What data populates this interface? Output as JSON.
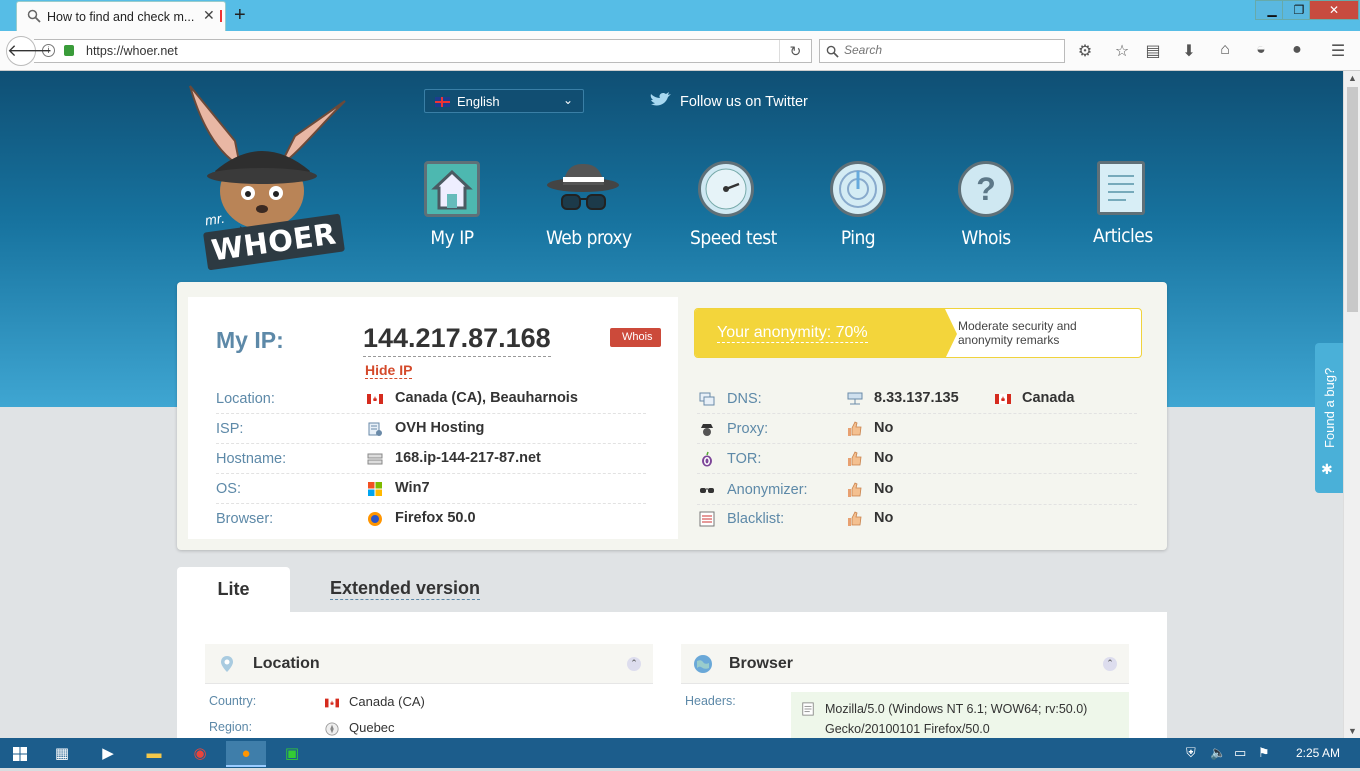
{
  "browser": {
    "tab_title": "How to find and check m...",
    "url": "https://whoer.net",
    "search_placeholder": "Search",
    "window_min": "▁",
    "window_max": "❐",
    "window_close": "✕"
  },
  "site": {
    "logo_mr": "mr.",
    "logo_name": "WHOER",
    "language": "English",
    "twitter": "Follow us on Twitter",
    "nav": [
      {
        "label": "My IP",
        "icon": "house-icon"
      },
      {
        "label": "Web proxy",
        "icon": "spy-hat-icon"
      },
      {
        "label": "Speed test",
        "icon": "speedometer-icon"
      },
      {
        "label": "Ping",
        "icon": "radar-icon"
      },
      {
        "label": "Whois",
        "icon": "question-icon"
      },
      {
        "label": "Articles",
        "icon": "document-icon"
      }
    ]
  },
  "ip_panel": {
    "my_ip_label": "My IP:",
    "ip": "144.217.87.168",
    "whois_badge": "Whois",
    "hide_ip": "Hide IP",
    "rows": [
      {
        "key": "Location:",
        "value": "Canada (CA), Beauharnois",
        "icon": "canada-flag-icon"
      },
      {
        "key": "ISP:",
        "value": "OVH Hosting",
        "icon": "isp-icon"
      },
      {
        "key": "Hostname:",
        "value": "168.ip-144-217-87.net",
        "icon": "server-icon"
      },
      {
        "key": "OS:",
        "value": "Win7",
        "icon": "windows-icon"
      },
      {
        "key": "Browser:",
        "value": "Firefox 50.0",
        "icon": "firefox-icon"
      }
    ],
    "anonymity": {
      "label": "Your anonymity: 70%",
      "value_percent": 70,
      "note": "Moderate security and anonymity remarks"
    },
    "right_rows": [
      {
        "key": "DNS:",
        "value": "8.33.137.135",
        "value2": "Canada",
        "icon": "dns-icon"
      },
      {
        "key": "Proxy:",
        "value": "No",
        "icon": "spy-icon"
      },
      {
        "key": "TOR:",
        "value": "No",
        "icon": "onion-icon"
      },
      {
        "key": "Anonymizer:",
        "value": "No",
        "icon": "glasses-icon"
      },
      {
        "key": "Blacklist:",
        "value": "No",
        "icon": "list-icon"
      }
    ]
  },
  "tabs": {
    "lite": "Lite",
    "extended": "Extended version"
  },
  "location_section": {
    "title": "Location",
    "country_key": "Country:",
    "country_value": "Canada (CA)",
    "region_key": "Region:",
    "region_value": "Quebec"
  },
  "browser_section": {
    "title": "Browser",
    "headers_key": "Headers:",
    "headers_value_line1": "Mozilla/5.0 (Windows NT 6.1; WOW64; rv:50.0)",
    "headers_value_line2": "Gecko/20100101 Firefox/50.0"
  },
  "bug_tab": "Found a bug?",
  "taskbar": {
    "clock": "2:25 AM"
  },
  "colors": {
    "accent_blue": "#5d89a8",
    "hide_ip_red": "#d44a2b",
    "anonymity_yellow": "#f3d53b",
    "taskbar": "#1c5d8c"
  }
}
